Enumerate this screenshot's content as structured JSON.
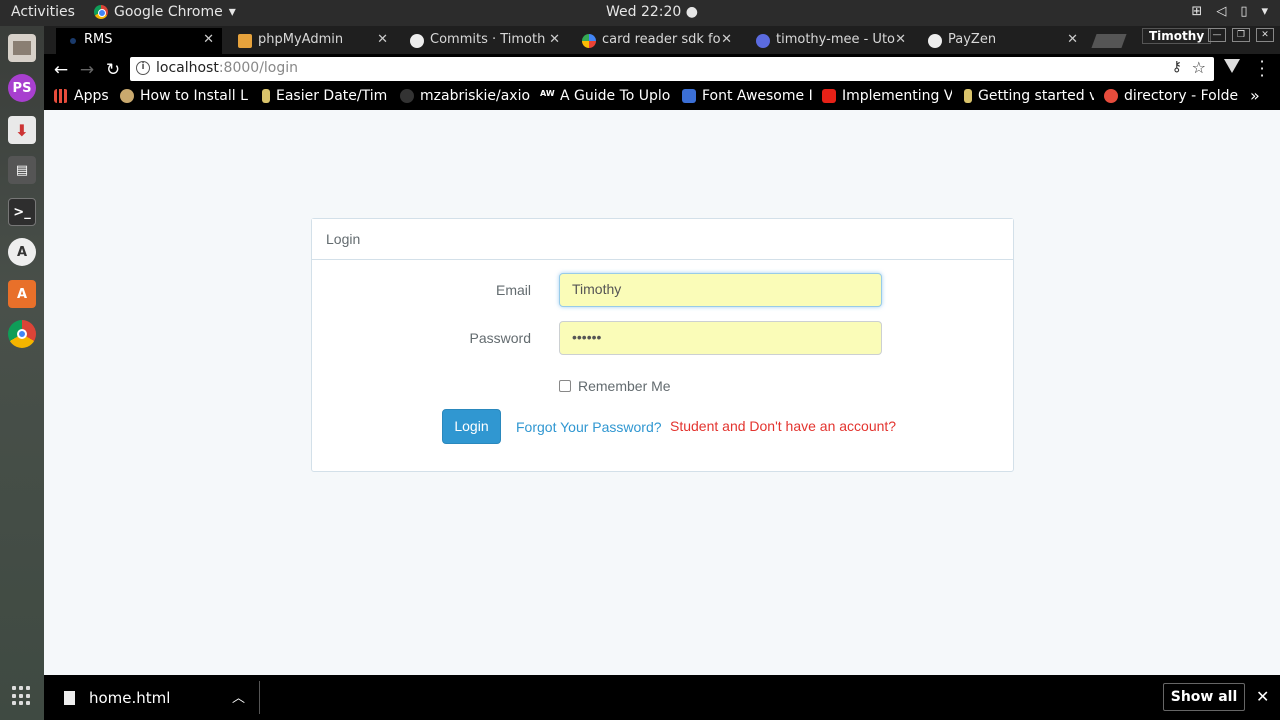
{
  "system": {
    "activities": "Activities",
    "app_name": "Google Chrome",
    "app_menu_arrow": "▾",
    "clock": "Wed 22:20 ●"
  },
  "browser": {
    "tabs": [
      {
        "title": "RMS",
        "active": true
      },
      {
        "title": "phpMyAdmin"
      },
      {
        "title": "Commits · Timoth"
      },
      {
        "title": "card reader sdk fo"
      },
      {
        "title": "timothy-mee - Uto"
      },
      {
        "title": "PayZen"
      }
    ],
    "profile_name": "Timothy",
    "omnibox": {
      "host": "localhost",
      "path": ":8000/login"
    },
    "bookmarks": [
      {
        "label": "Apps"
      },
      {
        "label": "How to Install La"
      },
      {
        "label": "Easier Date/Tim"
      },
      {
        "label": "mzabriskie/axio"
      },
      {
        "label": "A Guide To Uploa"
      },
      {
        "label": "Font Awesome I"
      },
      {
        "label": "Implementing V"
      },
      {
        "label": "Getting started v"
      },
      {
        "label": "directory - Folde"
      }
    ],
    "bookmarks_more": "»"
  },
  "login": {
    "heading": "Login",
    "email_label": "Email",
    "email_value": "Timothy",
    "password_label": "Password",
    "password_value": "••••••",
    "remember_label": "Remember Me",
    "login_button": "Login",
    "forgot_link": "Forgot Your Password?",
    "student_link": "Student and Don't have an account?"
  },
  "downloads": {
    "file_name": "home.html",
    "show_all": "Show all"
  },
  "colors": {
    "primary": "#3097d1",
    "danger": "#e3342f",
    "autofill": "#fafcb8"
  }
}
